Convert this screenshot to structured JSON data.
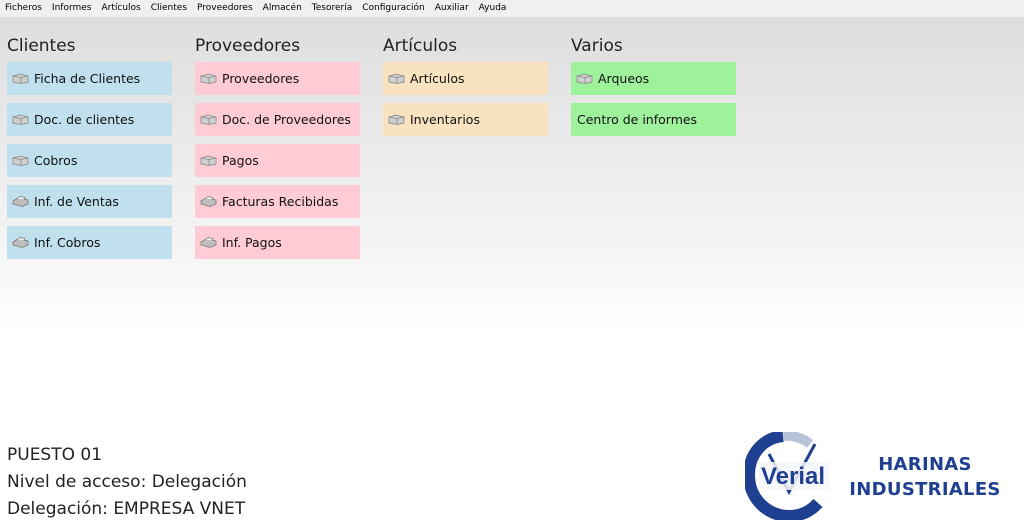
{
  "menu": [
    "Ficheros",
    "Informes",
    "Artículos",
    "Clientes",
    "Proveedores",
    "Almacén",
    "Tesorería",
    "Configuración",
    "Auxiliar",
    "Ayuda"
  ],
  "columns": [
    {
      "title": "Clientes",
      "color": "#bfe0ec",
      "items": [
        {
          "label": "Ficha de Clientes",
          "icon": "box-icon"
        },
        {
          "label": "Doc. de clientes",
          "icon": "box-icon"
        },
        {
          "label": "Cobros",
          "icon": "box-icon"
        },
        {
          "label": "Inf. de Ventas",
          "icon": "printer-icon"
        },
        {
          "label": "Inf. Cobros",
          "icon": "printer-icon"
        }
      ]
    },
    {
      "title": "Proveedores",
      "color": "#ffccd5",
      "items": [
        {
          "label": "Proveedores",
          "icon": "box-icon"
        },
        {
          "label": "Doc. de Proveedores",
          "icon": "box-icon"
        },
        {
          "label": "Pagos",
          "icon": "box-icon"
        },
        {
          "label": "Facturas Recibidas",
          "icon": "printer-icon"
        },
        {
          "label": "Inf. Pagos",
          "icon": "printer-icon"
        }
      ]
    },
    {
      "title": "Artículos",
      "color": "#f8e2bf",
      "items": [
        {
          "label": "Artículos",
          "icon": "box-icon"
        },
        {
          "label": "Inventarios",
          "icon": "box-icon"
        }
      ]
    },
    {
      "title": "Varios",
      "color": "#9ef29b",
      "items": [
        {
          "label": "Arqueos",
          "icon": "box-icon"
        },
        {
          "label": "Centro de informes",
          "icon": ""
        }
      ]
    }
  ],
  "info": {
    "puesto": "PUESTO 01",
    "nivel": "Nivel de acceso: Delegación",
    "delegacion": "Delegación: EMPRESA VNET"
  },
  "logo": {
    "text": "Verial"
  },
  "company": {
    "line1": "HARINAS",
    "line2": "INDUSTRIALES"
  }
}
